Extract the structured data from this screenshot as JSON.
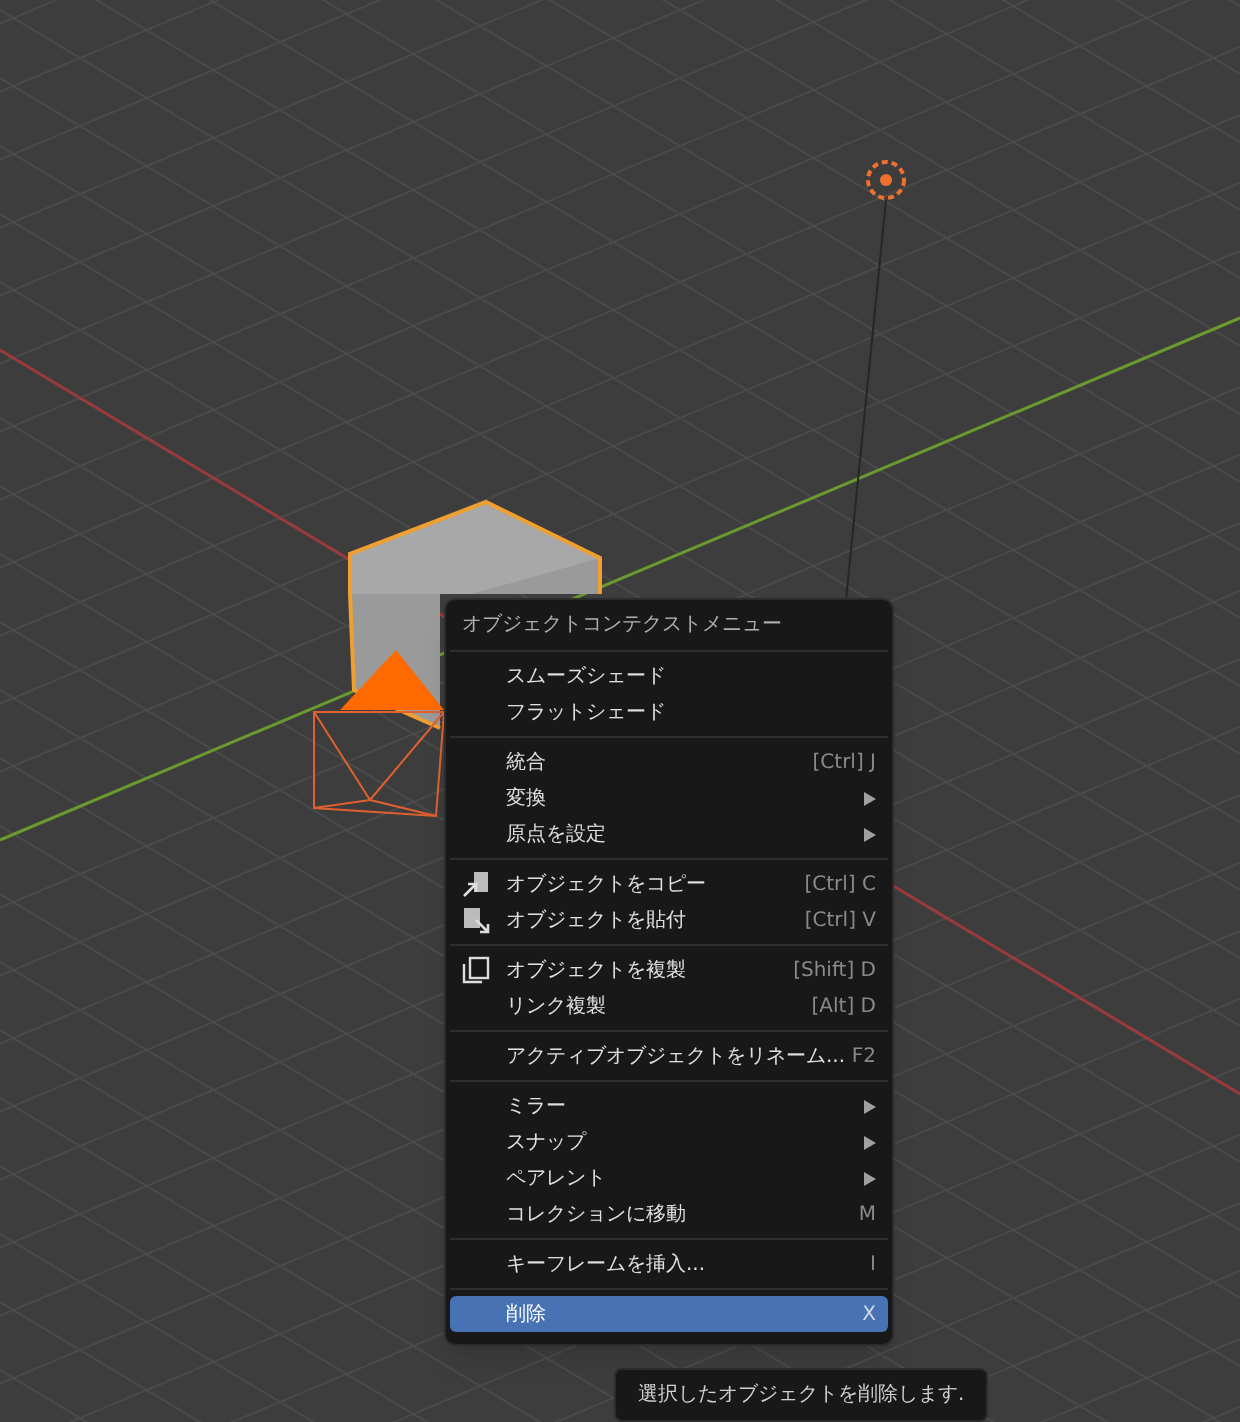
{
  "menu": {
    "title": "オブジェクトコンテクストメニュー",
    "groups": [
      [
        {
          "label": "スムーズシェード",
          "kind": "action",
          "selected": false
        },
        {
          "label": "フラットシェード",
          "kind": "action",
          "selected": false
        }
      ],
      [
        {
          "label": "統合",
          "shortcut": "[Ctrl] J",
          "kind": "action",
          "selected": false
        },
        {
          "label": "変換",
          "kind": "submenu",
          "selected": false
        },
        {
          "label": "原点を設定",
          "kind": "submenu",
          "selected": false
        }
      ],
      [
        {
          "label": "オブジェクトをコピー",
          "shortcut": "[Ctrl] C",
          "kind": "copy",
          "selected": false
        },
        {
          "label": "オブジェクトを貼付",
          "shortcut": "[Ctrl] V",
          "kind": "paste",
          "selected": false
        }
      ],
      [
        {
          "label": "オブジェクトを複製",
          "shortcut": "[Shift] D",
          "kind": "duplicate",
          "selected": false
        },
        {
          "label": "リンク複製",
          "shortcut": "[Alt] D",
          "kind": "action",
          "selected": false
        }
      ],
      [
        {
          "label": "アクティブオブジェクトをリネーム...",
          "shortcut": "F2",
          "kind": "action",
          "selected": false
        }
      ],
      [
        {
          "label": "ミラー",
          "kind": "submenu",
          "selected": false
        },
        {
          "label": "スナップ",
          "kind": "submenu",
          "selected": false
        },
        {
          "label": "ペアレント",
          "kind": "submenu",
          "selected": false
        },
        {
          "label": "コレクションに移動",
          "shortcut": "M",
          "kind": "action",
          "selected": false
        }
      ],
      [
        {
          "label": "キーフレームを挿入...",
          "shortcut": "I",
          "kind": "action",
          "selected": false
        }
      ],
      [
        {
          "label": "削除",
          "shortcut": "X",
          "kind": "action",
          "selected": true
        }
      ]
    ]
  },
  "tooltip": "選択したオブジェクトを削除します."
}
